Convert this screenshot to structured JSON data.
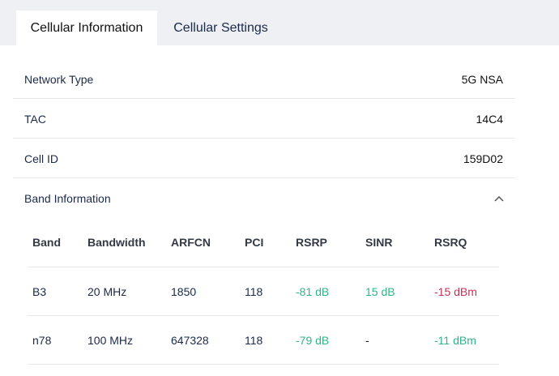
{
  "tabs": [
    {
      "label": "Cellular Information",
      "active": true
    },
    {
      "label": "Cellular Settings",
      "active": false
    }
  ],
  "info": {
    "network_type": {
      "label": "Network Type",
      "value": "5G NSA"
    },
    "tac": {
      "label": "TAC",
      "value": "14C4"
    },
    "cell_id": {
      "label": "Cell ID",
      "value": "159D02"
    }
  },
  "band_section": {
    "title": "Band Information",
    "icon": "chevron-up-icon",
    "columns": [
      "Band",
      "Bandwidth",
      "ARFCN",
      "PCI",
      "RSRP",
      "SINR",
      "RSRQ"
    ],
    "rows": [
      {
        "band": "B3",
        "bandwidth": "20 MHz",
        "arfcn": "1850",
        "pci": "118",
        "rsrp": "-81 dB",
        "sinr": "15 dB",
        "rsrq": "-15 dBm"
      },
      {
        "band": "n78",
        "bandwidth": "100 MHz",
        "arfcn": "647328",
        "pci": "118",
        "rsrp": "-79 dB",
        "sinr": "-",
        "rsrq": "-11 dBm"
      }
    ]
  },
  "colors": {
    "good": "#2eb58d",
    "bad": "#c0335a",
    "text": "#1b2a4a"
  }
}
